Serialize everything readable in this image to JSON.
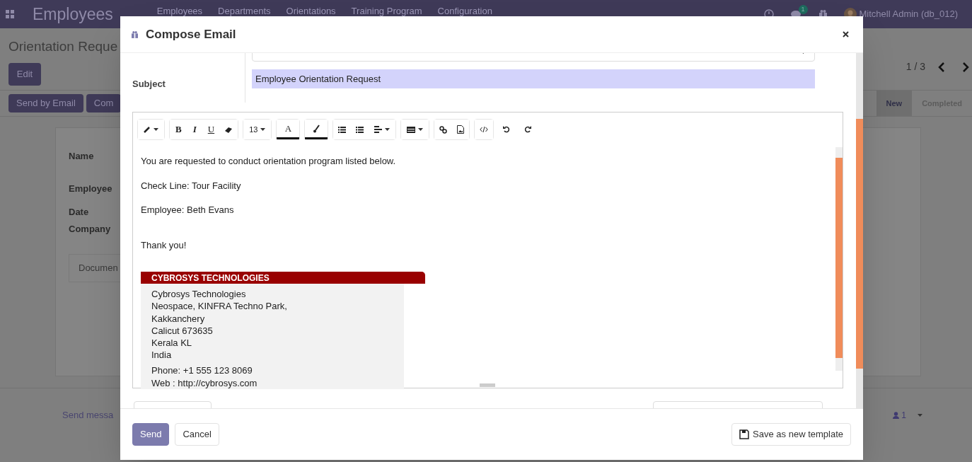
{
  "navbar": {
    "app_title": "Employees",
    "menu": [
      "Employees",
      "Departments",
      "Orientations",
      "Training Program",
      "Configuration"
    ],
    "message_count": "1",
    "user": "Mitchell Admin (db_012)"
  },
  "control_panel": {
    "breadcrumb": "Orientation Reque",
    "edit_button": "Edit",
    "pager": "1 / 3",
    "actions": [
      "Send by Email",
      "Com"
    ],
    "stages": [
      {
        "label": "New",
        "selected": true
      },
      {
        "label": "Completed",
        "selected": false
      }
    ]
  },
  "form": {
    "labels": [
      "Name",
      "Employee",
      "Date",
      "Company"
    ],
    "tab": "Documen"
  },
  "chatter": {
    "send_message": "Send messa",
    "followers": "1"
  },
  "dialog": {
    "title": "Compose Email",
    "subject_label": "Subject",
    "subject": "Employee Orientation Request",
    "toolbar": [
      [
        {
          "kind": "style",
          "caret": true
        }
      ],
      [
        {
          "kind": "bold",
          "label": "B"
        },
        {
          "kind": "italic",
          "label": "I"
        },
        {
          "kind": "underline",
          "label": "U"
        },
        {
          "kind": "eraser"
        }
      ],
      [
        {
          "kind": "size",
          "label": "13",
          "caret": true
        }
      ],
      [
        {
          "kind": "fore_color",
          "label": "A"
        }
      ],
      [
        {
          "kind": "back_color"
        }
      ],
      [
        {
          "kind": "bullets"
        },
        {
          "kind": "numbers"
        },
        {
          "kind": "align",
          "caret": true
        }
      ],
      [
        {
          "kind": "table",
          "caret": true
        }
      ],
      [
        {
          "kind": "link"
        },
        {
          "kind": "image"
        }
      ],
      [
        {
          "kind": "code"
        }
      ],
      [
        {
          "kind": "undo"
        }
      ],
      [
        {
          "kind": "redo"
        }
      ]
    ],
    "body": [
      "You are requested to conduct orientation program listed below.",
      "Check Line: Tour Facility",
      "Employee: Beth Evans"
    ],
    "closing": "Thank you!",
    "signature": {
      "heading": "CYBROSYS TECHNOLOGIES",
      "address": [
        "Cybrosys Technologies",
        "Neospace, KINFRA Techno Park,",
        "Kakkanchery",
        "Calicut 673635",
        "Kerala KL",
        "India"
      ],
      "contact": [
        "Phone:  +1 555 123 8069",
        "Web : http://cybrosys.com"
      ]
    },
    "buttons": [
      {
        "label": "Send",
        "kind": "primary"
      },
      {
        "label": "Cancel",
        "kind": "secondary"
      }
    ],
    "save_template": "Save as new template"
  }
}
